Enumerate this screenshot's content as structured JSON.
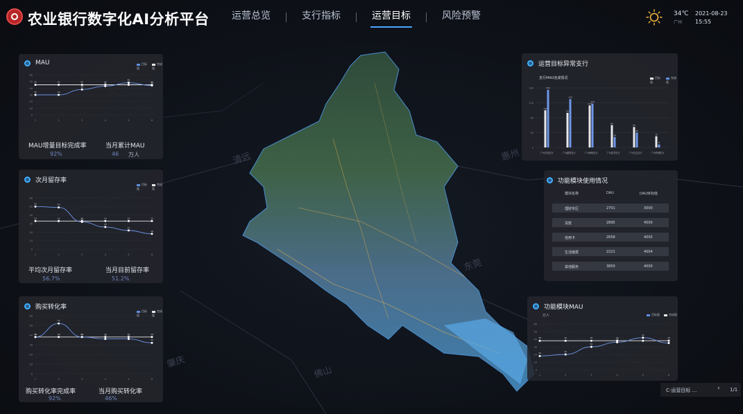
{
  "header": {
    "title": "农业银行数字化AI分析平台",
    "nav": [
      "运营总览",
      "支行指标",
      "运营目标",
      "风险预警"
    ],
    "active_nav": 2,
    "temperature": "34℃",
    "temperature_sub": "广州",
    "date": "2021-08-23",
    "time": "15:55"
  },
  "map_labels": [
    "清远",
    "惠州",
    "东莞",
    "肇庆",
    "佛山"
  ],
  "mau_panel": {
    "title": "MAU",
    "legend": [
      "目标值",
      "完成值"
    ],
    "kpi1_label": "MAU增量目标完成率",
    "kpi1_value": "92%",
    "kpi2_label": "当月累计MAU",
    "kpi2_value": "46",
    "kpi2_unit": "万人"
  },
  "retention_panel": {
    "title": "次月留存率",
    "legend": [
      "目标值",
      "完成值"
    ],
    "kpi1_label": "平均次月留存率",
    "kpi1_value": "56.7%",
    "kpi2_label": "当月目前留存率",
    "kpi2_value": "51.2%"
  },
  "conversion_panel": {
    "title": "购买转化率",
    "legend": [
      "目标值",
      "完成值"
    ],
    "kpi1_label": "购买转化率完成率",
    "kpi1_value": "92%",
    "kpi2_label": "当月购买转化率",
    "kpi2_value": "46%"
  },
  "branch_panel": {
    "title": "运营目标异常支行",
    "subtitle": "支行MAU完成情况",
    "legend": [
      "目标值",
      "完成值"
    ]
  },
  "module_panel": {
    "title": "功能模块使用情况",
    "columns": [
      "模块名称",
      "DAU",
      "DAU目标值"
    ],
    "rows": [
      [
        "理财专区",
        "2701",
        "3000"
      ],
      [
        "贷款",
        "2895",
        "4500"
      ],
      [
        "信用卡",
        "2658",
        "4005"
      ],
      [
        "生活缴费",
        "2221",
        "4004"
      ],
      [
        "其他服务",
        "3850",
        "4000"
      ]
    ]
  },
  "module_mau_panel": {
    "title": "功能模块MAU",
    "subtitle": "万人",
    "legend": [
      "目标值",
      "完成值"
    ]
  },
  "pager": {
    "label": "C-运营目标 ...",
    "prev": "‹",
    "page": "1/1"
  },
  "chart_data": [
    {
      "type": "line",
      "name": "MAU",
      "x": [
        1,
        2,
        3,
        4,
        5,
        6
      ],
      "series": [
        {
          "name": "目标值",
          "values": [
            45,
            45,
            45,
            45,
            45,
            45
          ]
        },
        {
          "name": "完成值",
          "values": [
            30,
            30,
            38,
            43,
            48,
            44
          ]
        }
      ],
      "ylim": [
        0,
        60
      ]
    },
    {
      "type": "line",
      "name": "次月留存率",
      "x": [
        1,
        2,
        3,
        4,
        5,
        6
      ],
      "series": [
        {
          "name": "目标值",
          "values": [
            33,
            33,
            33,
            33,
            33,
            33
          ]
        },
        {
          "name": "完成值",
          "values": [
            50,
            49,
            32,
            26,
            22,
            18
          ]
        }
      ],
      "ylim": [
        0,
        60
      ]
    },
    {
      "type": "line",
      "name": "购买转化率",
      "x": [
        1,
        2,
        3,
        4,
        5,
        6
      ],
      "series": [
        {
          "name": "目标值",
          "values": [
            38,
            38,
            38,
            38,
            38,
            38
          ]
        },
        {
          "name": "完成值",
          "values": [
            38,
            52,
            38,
            36,
            36,
            32
          ]
        }
      ],
      "ylim": [
        0,
        60
      ]
    },
    {
      "type": "bar",
      "name": "支行MAU完成情况",
      "categories": [
        "广州天河支行",
        "广州越秀支行",
        "广州海珠支行",
        "广州荔湾支行",
        "广州白云支行",
        "广州黄埔支行"
      ],
      "series": [
        {
          "name": "目标值",
          "values": [
            100,
            93,
            113,
            60,
            55,
            30
          ]
        },
        {
          "name": "完成值",
          "values": [
            155,
            130,
            118,
            28,
            40,
            8
          ]
        }
      ],
      "ylim": [
        0,
        160
      ]
    },
    {
      "type": "line",
      "name": "功能模块MAU",
      "x": [
        1,
        2,
        3,
        4,
        5,
        6
      ],
      "series": [
        {
          "name": "目标值",
          "values": [
            38,
            38,
            38,
            38,
            38,
            38
          ]
        },
        {
          "name": "完成值",
          "values": [
            18,
            20,
            30,
            36,
            42,
            35
          ]
        }
      ],
      "ylim": [
        0,
        60
      ]
    }
  ]
}
